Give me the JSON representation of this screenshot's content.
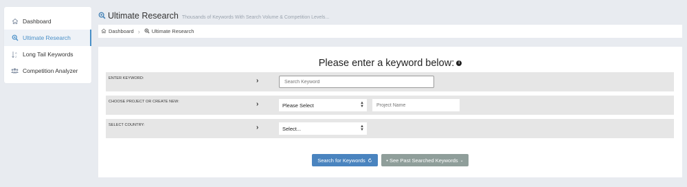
{
  "sidebar": {
    "items": [
      {
        "label": "Dashboard",
        "icon": "home-icon",
        "active": false
      },
      {
        "label": "Ultimate Research",
        "icon": "search-plus-icon",
        "active": true
      },
      {
        "label": "Long Tail Keywords",
        "icon": "sort-alpha-icon",
        "active": false
      },
      {
        "label": "Competition Analyzer",
        "icon": "users-icon",
        "active": false
      }
    ]
  },
  "header": {
    "title": "Ultimate Research",
    "subtitle": "Thousands of Keywords With Search Volume & Competition Levels..."
  },
  "breadcrumb": {
    "home": "Dashboard",
    "current": "Ultimate Research"
  },
  "form": {
    "heading": "Please enter a keyword below:",
    "keyword_label": "ENTER KEYWORD:",
    "keyword_placeholder": "Search Keyword",
    "project_label": "CHOOSE PROJECT OR CREATE NEW:",
    "project_select": "Please Select",
    "project_placeholder": "Project Name",
    "country_label": "SELECT COUNTRY:",
    "country_select": "Select..."
  },
  "buttons": {
    "search": "Search for Keywords",
    "past": "• See Past Searched Keywords"
  },
  "colors": {
    "accent": "#4a84bf",
    "secondary_button": "#8f9e9a",
    "background": "#e8ebf0"
  }
}
